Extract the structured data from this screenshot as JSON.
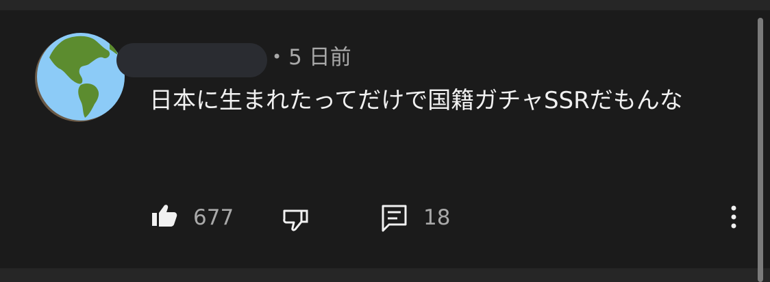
{
  "comment": {
    "time_label": "5 日前",
    "text": "日本に生まれたってだけで国籍ガチャSSRだもんな",
    "likes": "677",
    "replies": "18"
  },
  "icons": {
    "avatar": "globe-americas-icon",
    "like": "thumbs-up-icon",
    "dislike": "thumbs-down-icon",
    "reply": "comment-icon",
    "more": "more-vertical-icon"
  },
  "colors": {
    "background": "#1b1b1b",
    "text": "#f1f1f1",
    "secondary_text": "#a9a9a9",
    "globe_ocean": "#8ccbf7",
    "globe_land": "#5c8c2f"
  }
}
